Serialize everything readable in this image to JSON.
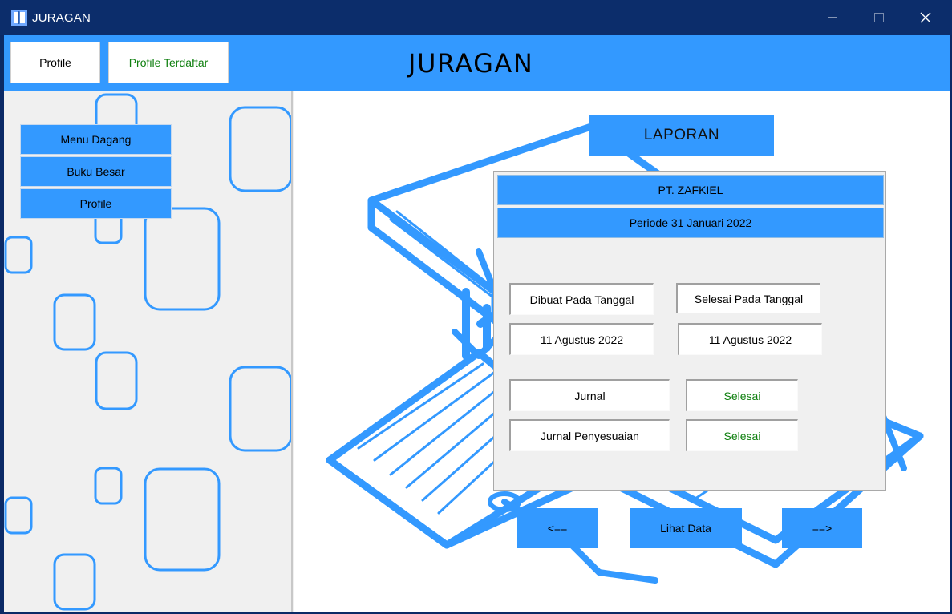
{
  "window": {
    "title": "JURAGAN",
    "minimize_icon": "minimize-icon",
    "maximize_icon": "maximize-icon",
    "close_icon": "close-icon"
  },
  "header": {
    "profile_button": "Profile",
    "registered_profile_button": "Profile Terdaftar",
    "app_title": "JURAGAN"
  },
  "sidebar": {
    "items": [
      {
        "label": "Menu Dagang"
      },
      {
        "label": "Buku Besar"
      },
      {
        "label": "Profile"
      }
    ]
  },
  "report": {
    "heading": "LAPORAN",
    "company": "PT. ZAFKIEL",
    "period": "Periode 31 Januari 2022",
    "created_label": "Dibuat Pada Tanggal",
    "finished_label": "Selesai Pada Tanggal",
    "created_date": "11 Agustus 2022",
    "finished_date": "11 Agustus 2022",
    "journals": [
      {
        "name": "Jurnal",
        "status": "Selesai"
      },
      {
        "name": "Jurnal Penyesuaian",
        "status": "Selesai"
      }
    ]
  },
  "nav": {
    "prev": "<==",
    "view": "Lihat Data",
    "next": "==>"
  },
  "colors": {
    "accent": "#3399ff",
    "titlebar": "#0c2d6b",
    "status_green": "#108010"
  }
}
